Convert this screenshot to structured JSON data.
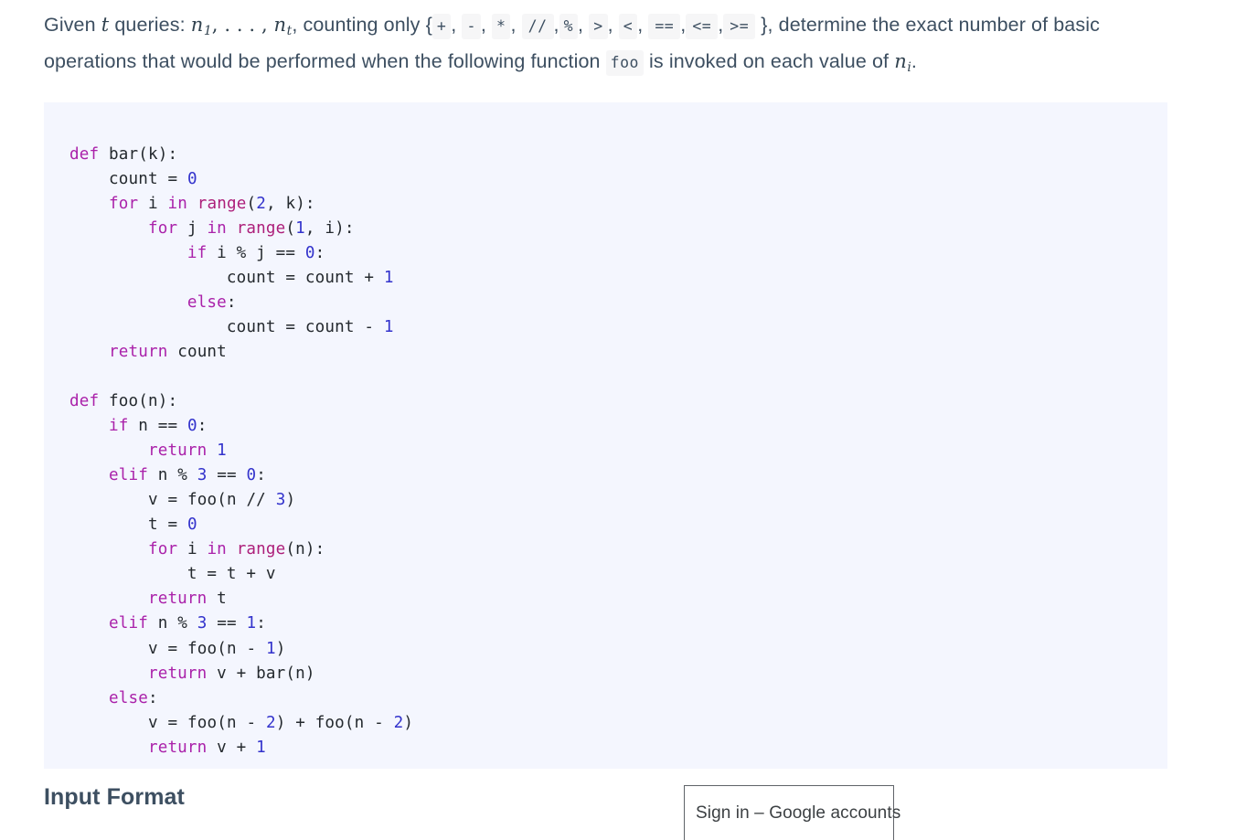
{
  "statement": {
    "part1": "Given ",
    "var_t": "t",
    "part2": " queries: ",
    "seq_n1": "n",
    "seq_n1_sub": "1",
    "seq_sep": ", . . . , ",
    "seq_nt": "n",
    "seq_nt_sub": "t",
    "part3": ", counting only {",
    "operators": [
      "+",
      "-",
      "*",
      "//",
      "%",
      ">",
      "<",
      "==",
      "<=",
      ">="
    ],
    "operator_separator": ",",
    "part4": "}, determine the exact number of basic operations that would be performed when the following function ",
    "function_chip": "foo",
    "part5": " is invoked on each value of ",
    "var_n": "n",
    "var_n_sub": "i",
    "part6": "."
  },
  "code_block": {
    "language": "python",
    "background_color": "#f4f6fe",
    "keyword_color": "#aa22aa",
    "builtin_color": "#ad1f7a",
    "number_color": "#3333cc",
    "lines": [
      "def bar(k):",
      "    count = 0",
      "    for i in range(2, k):",
      "        for j in range(1, i):",
      "            if i % j == 0:",
      "                count = count + 1",
      "            else:",
      "                count = count - 1",
      "    return count",
      "",
      "def foo(n):",
      "    if n == 0:",
      "        return 1",
      "    elif n % 3 == 0:",
      "        v = foo(n // 3)",
      "        t = 0",
      "        for i in range(n):",
      "            t = t + v",
      "        return t",
      "    elif n % 3 == 1:",
      "        v = foo(n - 1)",
      "        return v + bar(n)",
      "    else:",
      "        v = foo(n - 2) + foo(n - 2)",
      "        return v + 1"
    ]
  },
  "sections": {
    "input_format_heading": "Input Format"
  },
  "google_popup": {
    "title": "Sign in – Google accounts"
  }
}
